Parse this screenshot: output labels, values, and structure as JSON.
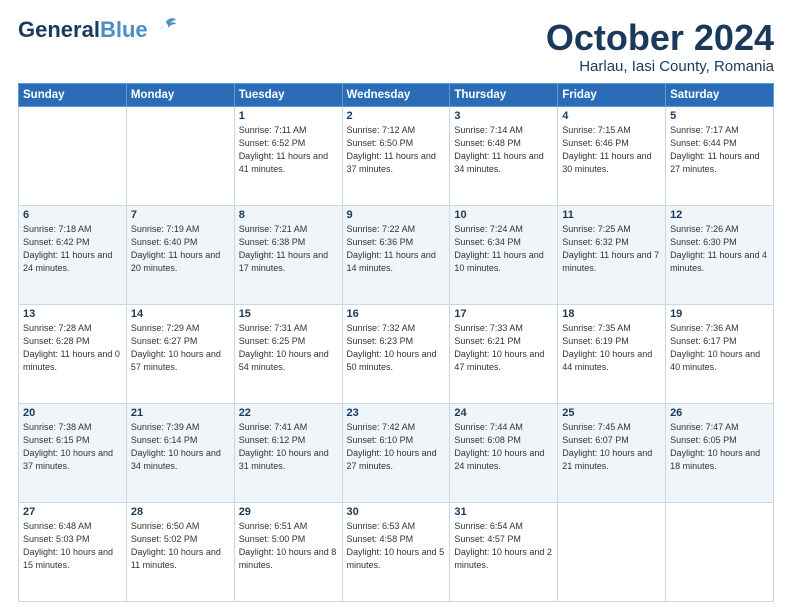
{
  "header": {
    "logo_general": "General",
    "logo_blue": "Blue",
    "month_title": "October 2024",
    "location": "Harlau, Iasi County, Romania"
  },
  "weekdays": [
    "Sunday",
    "Monday",
    "Tuesday",
    "Wednesday",
    "Thursday",
    "Friday",
    "Saturday"
  ],
  "weeks": [
    [
      {
        "day": "",
        "info": ""
      },
      {
        "day": "",
        "info": ""
      },
      {
        "day": "1",
        "info": "Sunrise: 7:11 AM\nSunset: 6:52 PM\nDaylight: 11 hours and 41 minutes."
      },
      {
        "day": "2",
        "info": "Sunrise: 7:12 AM\nSunset: 6:50 PM\nDaylight: 11 hours and 37 minutes."
      },
      {
        "day": "3",
        "info": "Sunrise: 7:14 AM\nSunset: 6:48 PM\nDaylight: 11 hours and 34 minutes."
      },
      {
        "day": "4",
        "info": "Sunrise: 7:15 AM\nSunset: 6:46 PM\nDaylight: 11 hours and 30 minutes."
      },
      {
        "day": "5",
        "info": "Sunrise: 7:17 AM\nSunset: 6:44 PM\nDaylight: 11 hours and 27 minutes."
      }
    ],
    [
      {
        "day": "6",
        "info": "Sunrise: 7:18 AM\nSunset: 6:42 PM\nDaylight: 11 hours and 24 minutes."
      },
      {
        "day": "7",
        "info": "Sunrise: 7:19 AM\nSunset: 6:40 PM\nDaylight: 11 hours and 20 minutes."
      },
      {
        "day": "8",
        "info": "Sunrise: 7:21 AM\nSunset: 6:38 PM\nDaylight: 11 hours and 17 minutes."
      },
      {
        "day": "9",
        "info": "Sunrise: 7:22 AM\nSunset: 6:36 PM\nDaylight: 11 hours and 14 minutes."
      },
      {
        "day": "10",
        "info": "Sunrise: 7:24 AM\nSunset: 6:34 PM\nDaylight: 11 hours and 10 minutes."
      },
      {
        "day": "11",
        "info": "Sunrise: 7:25 AM\nSunset: 6:32 PM\nDaylight: 11 hours and 7 minutes."
      },
      {
        "day": "12",
        "info": "Sunrise: 7:26 AM\nSunset: 6:30 PM\nDaylight: 11 hours and 4 minutes."
      }
    ],
    [
      {
        "day": "13",
        "info": "Sunrise: 7:28 AM\nSunset: 6:28 PM\nDaylight: 11 hours and 0 minutes."
      },
      {
        "day": "14",
        "info": "Sunrise: 7:29 AM\nSunset: 6:27 PM\nDaylight: 10 hours and 57 minutes."
      },
      {
        "day": "15",
        "info": "Sunrise: 7:31 AM\nSunset: 6:25 PM\nDaylight: 10 hours and 54 minutes."
      },
      {
        "day": "16",
        "info": "Sunrise: 7:32 AM\nSunset: 6:23 PM\nDaylight: 10 hours and 50 minutes."
      },
      {
        "day": "17",
        "info": "Sunrise: 7:33 AM\nSunset: 6:21 PM\nDaylight: 10 hours and 47 minutes."
      },
      {
        "day": "18",
        "info": "Sunrise: 7:35 AM\nSunset: 6:19 PM\nDaylight: 10 hours and 44 minutes."
      },
      {
        "day": "19",
        "info": "Sunrise: 7:36 AM\nSunset: 6:17 PM\nDaylight: 10 hours and 40 minutes."
      }
    ],
    [
      {
        "day": "20",
        "info": "Sunrise: 7:38 AM\nSunset: 6:15 PM\nDaylight: 10 hours and 37 minutes."
      },
      {
        "day": "21",
        "info": "Sunrise: 7:39 AM\nSunset: 6:14 PM\nDaylight: 10 hours and 34 minutes."
      },
      {
        "day": "22",
        "info": "Sunrise: 7:41 AM\nSunset: 6:12 PM\nDaylight: 10 hours and 31 minutes."
      },
      {
        "day": "23",
        "info": "Sunrise: 7:42 AM\nSunset: 6:10 PM\nDaylight: 10 hours and 27 minutes."
      },
      {
        "day": "24",
        "info": "Sunrise: 7:44 AM\nSunset: 6:08 PM\nDaylight: 10 hours and 24 minutes."
      },
      {
        "day": "25",
        "info": "Sunrise: 7:45 AM\nSunset: 6:07 PM\nDaylight: 10 hours and 21 minutes."
      },
      {
        "day": "26",
        "info": "Sunrise: 7:47 AM\nSunset: 6:05 PM\nDaylight: 10 hours and 18 minutes."
      }
    ],
    [
      {
        "day": "27",
        "info": "Sunrise: 6:48 AM\nSunset: 5:03 PM\nDaylight: 10 hours and 15 minutes."
      },
      {
        "day": "28",
        "info": "Sunrise: 6:50 AM\nSunset: 5:02 PM\nDaylight: 10 hours and 11 minutes."
      },
      {
        "day": "29",
        "info": "Sunrise: 6:51 AM\nSunset: 5:00 PM\nDaylight: 10 hours and 8 minutes."
      },
      {
        "day": "30",
        "info": "Sunrise: 6:53 AM\nSunset: 4:58 PM\nDaylight: 10 hours and 5 minutes."
      },
      {
        "day": "31",
        "info": "Sunrise: 6:54 AM\nSunset: 4:57 PM\nDaylight: 10 hours and 2 minutes."
      },
      {
        "day": "",
        "info": ""
      },
      {
        "day": "",
        "info": ""
      }
    ]
  ]
}
